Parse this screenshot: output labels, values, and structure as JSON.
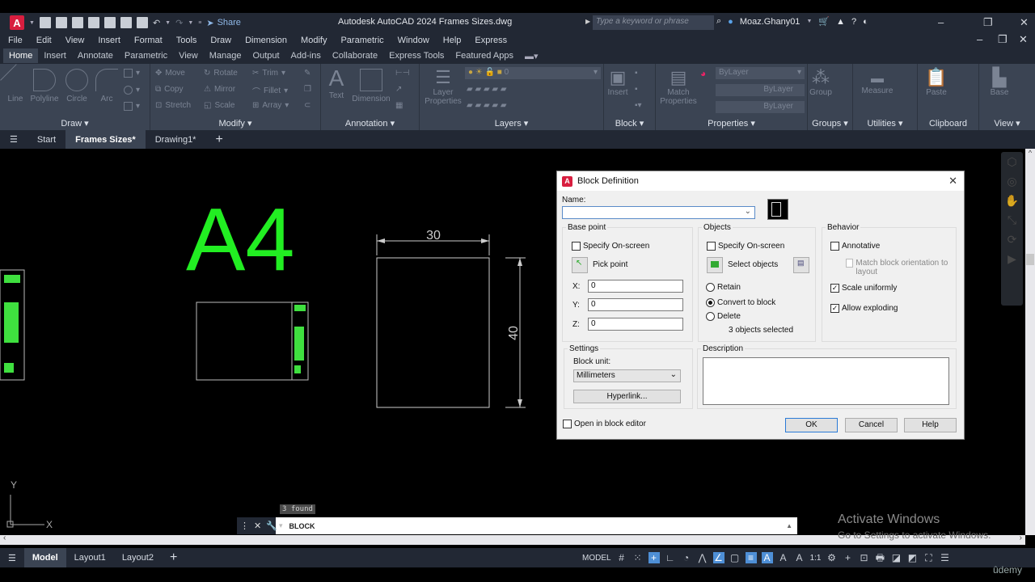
{
  "app": {
    "title": "Autodesk AutoCAD 2024   Frames Sizes.dwg",
    "share": "Share",
    "search_placeholder": "Type a keyword or phrase",
    "user": "Moaz.Ghany01"
  },
  "menu": [
    "File",
    "Edit",
    "View",
    "Insert",
    "Format",
    "Tools",
    "Draw",
    "Dimension",
    "Modify",
    "Parametric",
    "Window",
    "Help",
    "Express"
  ],
  "ribbon_tabs": [
    {
      "label": "Home",
      "active": true
    },
    {
      "label": "Insert"
    },
    {
      "label": "Annotate"
    },
    {
      "label": "Parametric"
    },
    {
      "label": "View"
    },
    {
      "label": "Manage"
    },
    {
      "label": "Output"
    },
    {
      "label": "Add-ins"
    },
    {
      "label": "Collaborate"
    },
    {
      "label": "Express Tools"
    },
    {
      "label": "Featured Apps"
    }
  ],
  "ribbon": {
    "draw": {
      "label": "Draw",
      "tools": [
        "Line",
        "Polyline",
        "Circle",
        "Arc"
      ]
    },
    "modify": {
      "label": "Modify",
      "tools": [
        "Move",
        "Rotate",
        "Trim",
        "Copy",
        "Mirror",
        "Fillet",
        "Stretch",
        "Scale",
        "Array"
      ]
    },
    "annotation": {
      "label": "Annotation",
      "tools": [
        "Text",
        "Dimension"
      ]
    },
    "layers": {
      "label": "Layers",
      "tool": "Layer Properties",
      "current_layer": "0"
    },
    "block": {
      "label": "Block",
      "tool": "Insert"
    },
    "properties": {
      "label": "Properties",
      "tool": "Match Properties",
      "color": "ByLayer",
      "linetype": "ByLayer",
      "lineweight": "ByLayer"
    },
    "groups": {
      "label": "Groups",
      "tool": "Group"
    },
    "utilities": {
      "label": "Utilities",
      "tool": "Measure"
    },
    "clipboard": {
      "label": "Clipboard",
      "tool": "Paste"
    },
    "view": {
      "label": "View",
      "tool": "Base"
    }
  },
  "file_tabs": [
    {
      "label": "Start"
    },
    {
      "label": "Frames Sizes*",
      "active": true
    },
    {
      "label": "Drawing1*"
    }
  ],
  "drawing": {
    "big_label": "A4",
    "dim_width": "30",
    "dim_height": "40",
    "ucs_x": "X",
    "ucs_y": "Y"
  },
  "command": {
    "found": "3 found",
    "text": "BLOCK"
  },
  "layout_tabs": [
    {
      "label": "Model",
      "active": true
    },
    {
      "label": "Layout1"
    },
    {
      "label": "Layout2"
    }
  ],
  "status": {
    "model": "MODEL",
    "scale": "1:1"
  },
  "watermark": {
    "activate": "Activate Windows",
    "activate_sub": "Go to Settings to activate Windows.",
    "udemy": "ûdemy"
  },
  "dialog": {
    "title": "Block Definition",
    "name_label": "Name:",
    "name_value": "",
    "base_point": {
      "legend": "Base point",
      "specify": "Specify On-screen",
      "specify_checked": false,
      "pick": "Pick point",
      "x_label": "X:",
      "x": "0",
      "y_label": "Y:",
      "y": "0",
      "z_label": "Z:",
      "z": "0"
    },
    "objects": {
      "legend": "Objects",
      "specify": "Specify On-screen",
      "specify_checked": false,
      "select": "Select objects",
      "retain": "Retain",
      "convert": "Convert to block",
      "delete": "Delete",
      "selected_option": "Convert to block",
      "count": "3 objects selected"
    },
    "behavior": {
      "legend": "Behavior",
      "annotative": "Annotative",
      "annotative_checked": false,
      "match": "Match block orientation to layout",
      "scale": "Scale uniformly",
      "scale_checked": true,
      "explode": "Allow exploding",
      "explode_checked": true
    },
    "settings": {
      "legend": "Settings",
      "unit_label": "Block unit:",
      "unit": "Millimeters",
      "hyperlink": "Hyperlink..."
    },
    "description": {
      "legend": "Description",
      "value": ""
    },
    "open_editor": "Open in block editor",
    "open_editor_checked": false,
    "ok": "OK",
    "cancel": "Cancel",
    "help": "Help"
  }
}
